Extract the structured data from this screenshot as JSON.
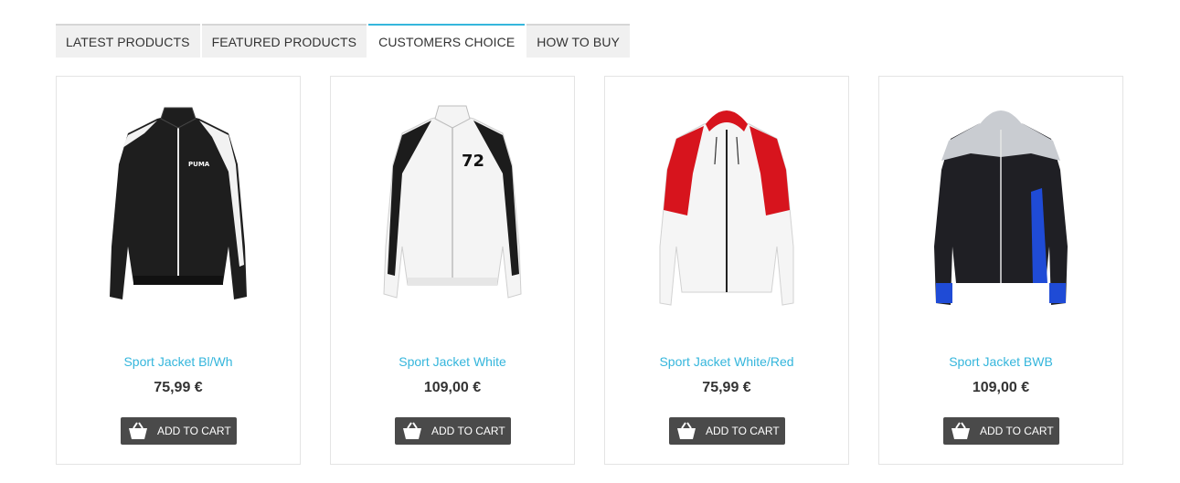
{
  "tabs": [
    {
      "label": "LATEST PRODUCTS",
      "active": false
    },
    {
      "label": "FEATURED PRODUCTS",
      "active": false
    },
    {
      "label": "CUSTOMERS CHOICE",
      "active": true
    },
    {
      "label": "HOW TO BUY",
      "active": false
    }
  ],
  "products": [
    {
      "name": "Sport Jacket Bl/Wh",
      "price": "75,99 €",
      "cart_label": "ADD TO CART",
      "image_icon": "black-white-track-jacket"
    },
    {
      "name": "Sport Jacket White",
      "price": "109,00 €",
      "cart_label": "ADD TO CART",
      "image_icon": "white-track-jacket-72"
    },
    {
      "name": "Sport Jacket White/Red",
      "price": "75,99 €",
      "cart_label": "ADD TO CART",
      "image_icon": "white-red-hooded-jacket"
    },
    {
      "name": "Sport Jacket BWB",
      "price": "109,00 €",
      "cart_label": "ADD TO CART",
      "image_icon": "black-white-blue-hooded-jacket"
    }
  ],
  "jacket_print": "72",
  "brand_logo": "PUMA",
  "colors": {
    "accent": "#35b6dc",
    "button": "#4a4a4a",
    "tab_bg": "#f0f0f0"
  }
}
